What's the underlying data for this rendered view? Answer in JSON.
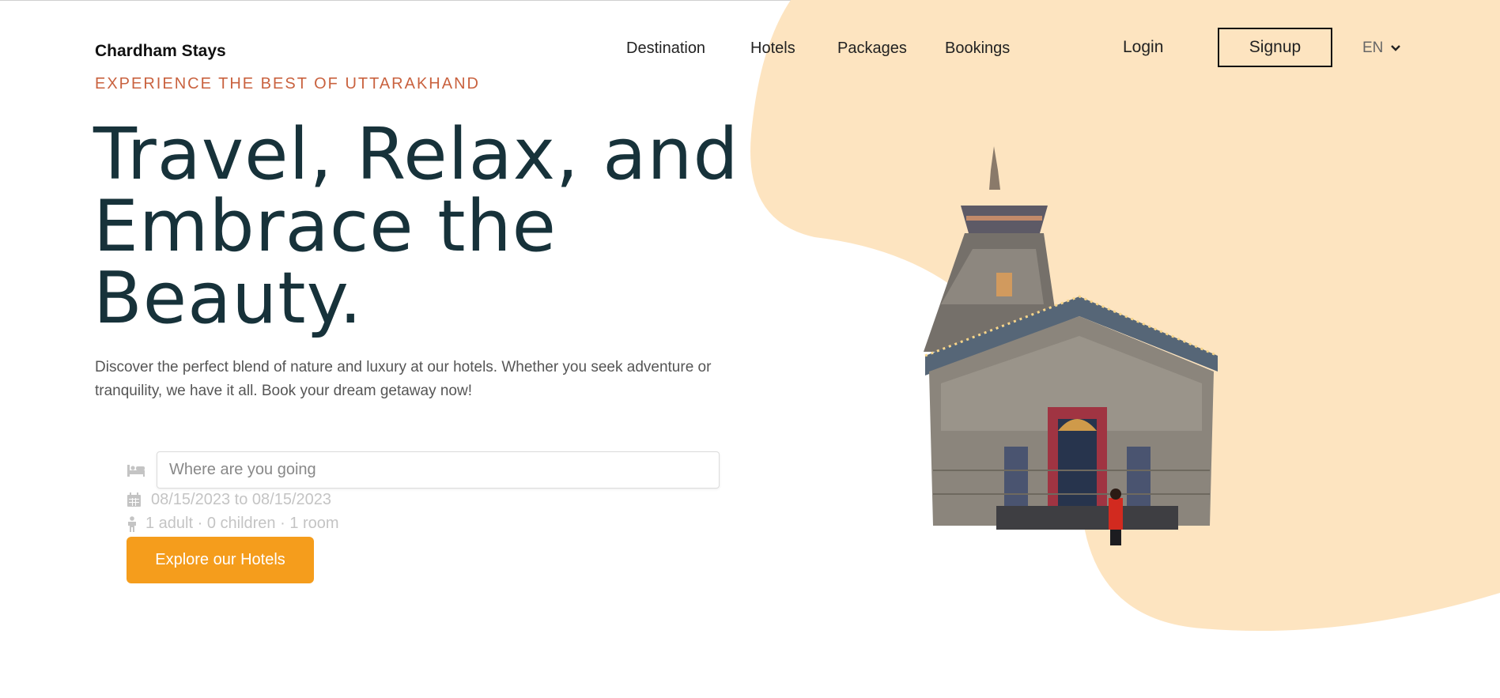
{
  "header": {
    "brand": "Chardham Stays",
    "nav": [
      "Destination",
      "Hotels",
      "Packages",
      "Bookings"
    ],
    "login_label": "Login",
    "signup_label": "Signup",
    "language": "EN"
  },
  "hero": {
    "tagline": "EXPERIENCE THE BEST OF UTTARAKHAND",
    "headline_lines": [
      "Travel, Relax, and",
      "Embrace the",
      "Beauty."
    ],
    "description": "Discover the perfect blend of nature and luxury at our hotels. Whether you seek adventure or tranquility, we have it all. Book your dream getaway now!"
  },
  "search": {
    "destination_placeholder": "Where are you going",
    "destination_value": "",
    "dates": "08/15/2023 to 08/15/2023",
    "guests": "1 adult · 0 children · 1 room",
    "submit_label": "Explore our Hotels"
  },
  "icons": {
    "destination": "bed-icon",
    "dates": "calendar-icon",
    "guests": "person-icon",
    "language_dropdown": "chevron-down-icon"
  },
  "colors": {
    "accent": "#f59d1c",
    "tagline": "#c9623f",
    "heading": "#17323a",
    "blob": "#fde4c0"
  }
}
